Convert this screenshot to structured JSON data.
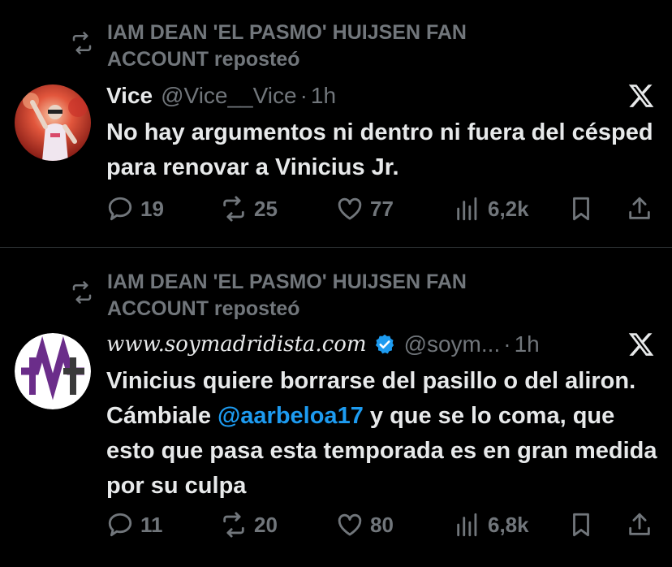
{
  "tweets": [
    {
      "reposted_by": "IAM DEAN 'EL PASMO' HUIJSEN FAN ACCOUNT reposteó",
      "author_name": "Vice",
      "handle": "@Vice__Vice",
      "separator": "·",
      "time": "1h",
      "text": "No hay argumentos ni dentro ni fuera del césped para renovar a Vinicius Jr.",
      "replies": "19",
      "reposts": "25",
      "likes": "77",
      "views": "6,2k"
    },
    {
      "reposted_by": "IAM DEAN 'EL PASMO' HUIJSEN FAN ACCOUNT reposteó",
      "author_name": "www.soymadridista.com",
      "handle": "@soym...",
      "separator": "·",
      "time": "1h",
      "text_part1": "Vinicius quiere borrarse del pasillo o del aliron. Cámbiale ",
      "mention": "@aarbeloa17",
      "text_part2": " y que se lo coma, que esto que pasa esta temporada es en gran medida por su culpa",
      "replies": "11",
      "reposts": "20",
      "likes": "80",
      "views": "6,8k"
    }
  ],
  "colors": {
    "background": "#000000",
    "text": "#e7e9ea",
    "muted": "#71767b",
    "accent": "#1d9bf0",
    "divider": "#2f3336",
    "brand_purple": "#6b2d8a"
  },
  "icons": [
    "repost-icon",
    "reply-icon",
    "retweet-icon",
    "like-icon",
    "views-icon",
    "bookmark-icon",
    "share-icon",
    "x-logo-icon",
    "verified-icon"
  ]
}
